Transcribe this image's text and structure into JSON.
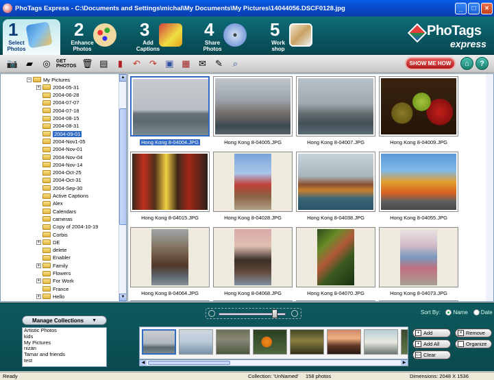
{
  "window": {
    "title": "PhoTags Express - C:\\Documents and Settings\\michal\\My Documents\\My Pictures\\14044056.DSCF0128.jpg"
  },
  "steps": [
    {
      "num": "1",
      "label_line1": "Select",
      "label_line2": "Photos",
      "active": true
    },
    {
      "num": "2",
      "label_line1": "Enhance",
      "label_line2": "Photos",
      "active": false
    },
    {
      "num": "3",
      "label_line1": "Add",
      "label_line2": "Captions",
      "active": false
    },
    {
      "num": "4",
      "label_line1": "Share",
      "label_line2": "Photos",
      "active": false
    },
    {
      "num": "5",
      "label_line1": "Work",
      "label_line2": "shop",
      "active": false
    }
  ],
  "brand": {
    "name": "PhoTags",
    "sub": "express"
  },
  "toolbar": {
    "get_photos_line1": "GET",
    "get_photos_line2": "PHOTOS",
    "show_me_how": "SHOW ME HOW",
    "home_glyph": "⌂",
    "help_glyph": "?"
  },
  "tree": {
    "items": [
      {
        "label": "My Pictures",
        "indent": 0,
        "expander": "−"
      },
      {
        "label": "2004-05-31",
        "indent": 1,
        "expander": "+"
      },
      {
        "label": "2004-06-28",
        "indent": 1,
        "expander": ""
      },
      {
        "label": "2004-07-07",
        "indent": 1,
        "expander": ""
      },
      {
        "label": "2004-07-18",
        "indent": 1,
        "expander": ""
      },
      {
        "label": "2004-08-15",
        "indent": 1,
        "expander": ""
      },
      {
        "label": "2004-08-31",
        "indent": 1,
        "expander": ""
      },
      {
        "label": "2004-09-01",
        "indent": 1,
        "expander": "",
        "selected": true
      },
      {
        "label": "2004-Nov1-05",
        "indent": 1,
        "expander": ""
      },
      {
        "label": "2004-Nov-01",
        "indent": 1,
        "expander": ""
      },
      {
        "label": "2004-Nov-04",
        "indent": 1,
        "expander": ""
      },
      {
        "label": "2004-Nov-14",
        "indent": 1,
        "expander": ""
      },
      {
        "label": "2004-Oct-25",
        "indent": 1,
        "expander": ""
      },
      {
        "label": "2004-Oct-31",
        "indent": 1,
        "expander": ""
      },
      {
        "label": "2004-Sep-30",
        "indent": 1,
        "expander": ""
      },
      {
        "label": "Active Captions",
        "indent": 1,
        "expander": ""
      },
      {
        "label": "Alex",
        "indent": 1,
        "expander": ""
      },
      {
        "label": "Calendars",
        "indent": 1,
        "expander": ""
      },
      {
        "label": "cameras",
        "indent": 1,
        "expander": ""
      },
      {
        "label": "Copy of 2004-10-19",
        "indent": 1,
        "expander": ""
      },
      {
        "label": "Corbis",
        "indent": 1,
        "expander": ""
      },
      {
        "label": "DE",
        "indent": 1,
        "expander": "+"
      },
      {
        "label": "delete",
        "indent": 1,
        "expander": ""
      },
      {
        "label": "Enabler",
        "indent": 1,
        "expander": ""
      },
      {
        "label": "Family",
        "indent": 1,
        "expander": "+"
      },
      {
        "label": "Flowers",
        "indent": 1,
        "expander": ""
      },
      {
        "label": "For Work",
        "indent": 1,
        "expander": "+"
      },
      {
        "label": "France",
        "indent": 1,
        "expander": ""
      },
      {
        "label": "Hello",
        "indent": 1,
        "expander": "+"
      }
    ]
  },
  "thumbnails": [
    {
      "caption": "Hong Kong 8-04004.JPG",
      "selected": true,
      "bg": "linear-gradient(#c8ccd0 0%, #b8bec4 55%, #6a7078 62%, #5a6a70 75%, #7a8a90 100%)",
      "orient": "land"
    },
    {
      "caption": "Hong Kong 8-04005.JPG",
      "selected": false,
      "bg": "linear-gradient(#c0c8cc 0%, #9aa0a8 40%, #7a7270 60%, #3c4a52 85%, #56646a 100%)",
      "orient": "land"
    },
    {
      "caption": "Hong Kong 8-04007.JPG",
      "selected": false,
      "bg": "linear-gradient(#b8c0c8 0%, #a0a8b0 45%, #60686c 65%, #445058 80%, #5a6c74 100%)",
      "orient": "land"
    },
    {
      "caption": "Hong Kong 8-04009.JPG",
      "selected": false,
      "bg": "radial-gradient(circle at 28% 62%, #8a7a28 0, #6a5c18 16%, transparent 17%), radial-gradient(circle at 54% 42%, #a8c040 0, #78a020 17%, transparent 18%), radial-gradient(circle at 78% 60%, #c02018 0, #8a1010 19%, transparent 20%), linear-gradient(#3a2410, #241408)",
      "orient": "land"
    },
    {
      "caption": "Hong Kong 8-04015.JPG",
      "selected": false,
      "bg": "linear-gradient(90deg, #3a2818 0%, #c03020 15%, #503018 30%, #f0d040 45%, #402818 60%, #a02818 75%, #302018 100%)",
      "orient": "land"
    },
    {
      "caption": "Hong Kong 8-04028.JPG",
      "selected": false,
      "bg": "linear-gradient(#7aa4d8 0%, #a8c4e8 35%, #c04038 55%, #8a6040 75%, #b0a088 100%)",
      "orient": "port"
    },
    {
      "caption": "Hong Kong 8-04038.JPG",
      "selected": false,
      "bg": "linear-gradient(#c8d4dc 0%, #a8b4bc 40%, #8a5030 55%, #c88030 65%, #3a6478 80%, #2a5468 100%)",
      "orient": "land"
    },
    {
      "caption": "Hong Kong 8-04055.JPG",
      "selected": false,
      "bg": "linear-gradient(#5a9ad8 0%, #80b8e8 30%, #e0a030 50%, #d86020 70%, #606060 85%, #484848 100%)",
      "orient": "land"
    },
    {
      "caption": "Hong Kong 8-04064.JPG",
      "selected": false,
      "bg": "linear-gradient(#a0a8a8 0%, #7a6450 40%, #503828 65%, #606870 85%, #889098 100%)",
      "orient": "port"
    },
    {
      "caption": "Hong Kong 8-04068.JPG",
      "selected": false,
      "bg": "linear-gradient(#d8a8a8 0%, #e0c0b0 30%, #3a3028 55%, #604838 75%, #8090a0 100%)",
      "orient": "port"
    },
    {
      "caption": "Hong Kong 8-04070.JPG",
      "selected": false,
      "bg": "linear-gradient(135deg, #2a4a18 0%, #6a8a28 25%, #b05838 45%, #3a5a20 65%, #1a3010 100%)",
      "orient": "port"
    },
    {
      "caption": "Hong Kong 8-04073.JPG",
      "selected": false,
      "bg": "linear-gradient(#e8e4e0 0%, #d0b8c8 30%, #7a9ac0 50%, #c07080 70%, #a8a090 100%)",
      "orient": "port"
    }
  ],
  "lower": {
    "sort_by_label": "Sort By:",
    "sort_name": "Name",
    "sort_date": "Date",
    "manage_collections": "Manage Collections",
    "manage_caret": "▼",
    "collections": [
      "Artistic Photos",
      "kids",
      "My Pictures",
      "nizan",
      "Tamar and friends",
      "test"
    ],
    "tray_thumbs": [
      "linear-gradient(#c8ccd0 0%, #b0b8c0 55%, #5a6a70 75%, #7a8a90 100%)",
      "linear-gradient(#d0d8e0 0%, #b8c8d8 50%, #7890a8 100%)",
      "linear-gradient(#6a7058 0%, #8a8878 40%, #4a5840 100%)",
      "radial-gradient(circle at 40% 50%, #f09020 0, #e07010 22%, transparent 24%), linear-gradient(#2a4020, #506840)",
      "linear-gradient(#404828 0%, #8a8040 45%, #303018 100%)",
      "linear-gradient(#d08868 0%, #f0b080 35%, #603828 65%, #281810 100%)",
      "linear-gradient(#b8ccd8 0%, #e8e8e0 50%, #6a7870 100%)",
      "linear-gradient(#3a4830 0%, #607848 100%)"
    ],
    "btn_add": "Add",
    "btn_add_all": "Add All",
    "btn_clear": "Clear",
    "btn_remove": "Remove",
    "btn_organize": "Organize"
  },
  "status": {
    "left": "Ready",
    "collection": "Collection: 'UnNamed'",
    "count": "158 photos",
    "dimensions": "Dimensions: 2048 X 1536"
  }
}
